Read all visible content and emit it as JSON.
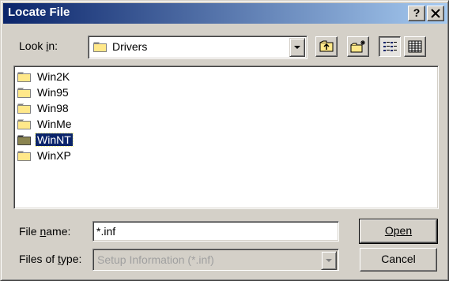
{
  "window": {
    "title": "Locate File",
    "help_label": "?",
    "close_label": "✕"
  },
  "lookin": {
    "label": "Look in:",
    "value": "Drivers",
    "folder_color": "#ffe88a"
  },
  "toolbar": {
    "icons": [
      "up-one-level-icon",
      "create-new-folder-icon",
      "list-view-icon",
      "details-view-icon"
    ]
  },
  "files": [
    {
      "label": "Win2K",
      "selected": false
    },
    {
      "label": "Win95",
      "selected": false
    },
    {
      "label": "Win98",
      "selected": false
    },
    {
      "label": "WinMe",
      "selected": false
    },
    {
      "label": "WinNT",
      "selected": true
    },
    {
      "label": "WinXP",
      "selected": false
    }
  ],
  "filename": {
    "label": "File name:",
    "value": "*.inf"
  },
  "filetype": {
    "label": "Files of type:",
    "value": "Setup Information (*.inf)"
  },
  "buttons": {
    "open_label": "Open",
    "cancel_label": "Cancel"
  },
  "colors": {
    "titlebar_start": "#0a246a",
    "titlebar_end": "#a6caf0",
    "selection": "#0a246a"
  }
}
